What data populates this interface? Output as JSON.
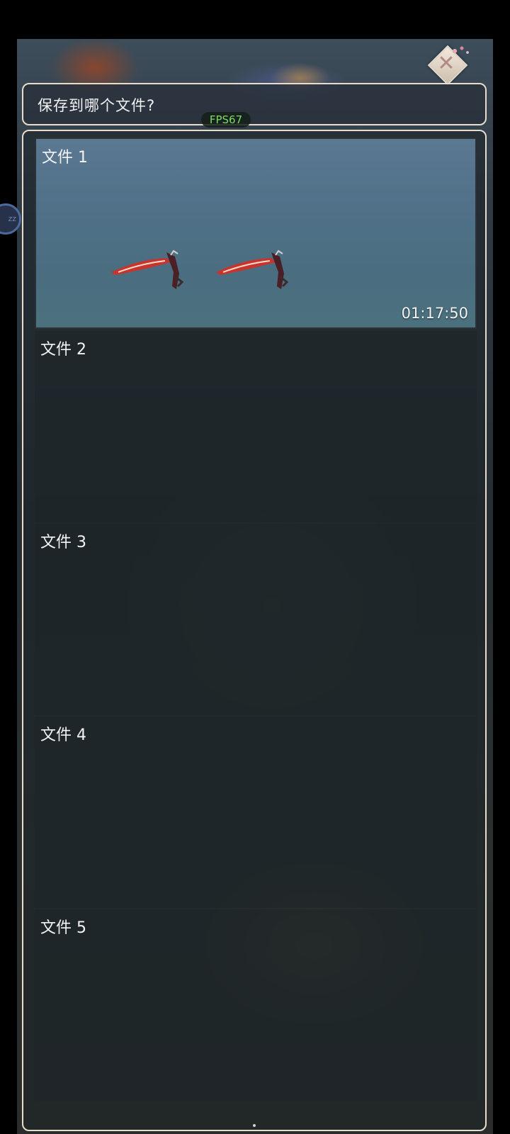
{
  "dialog": {
    "title": "保存到哪个文件?",
    "close_icon": "close-icon"
  },
  "overlay": {
    "fps": "FPS67",
    "side_bubble": "zz"
  },
  "save_slots": [
    {
      "label": "文件 1",
      "time": "01:17:50",
      "has_thumbnail": true
    },
    {
      "label": "文件 2",
      "time": "",
      "has_thumbnail": false
    },
    {
      "label": "文件 3",
      "time": "",
      "has_thumbnail": false
    },
    {
      "label": "文件 4",
      "time": "",
      "has_thumbnail": false
    },
    {
      "label": "文件 5",
      "time": "",
      "has_thumbnail": false
    }
  ],
  "colors": {
    "frame_border": "#e8dccb",
    "fps_text": "#7cdc62",
    "thumbnail_sky": "#507189"
  }
}
